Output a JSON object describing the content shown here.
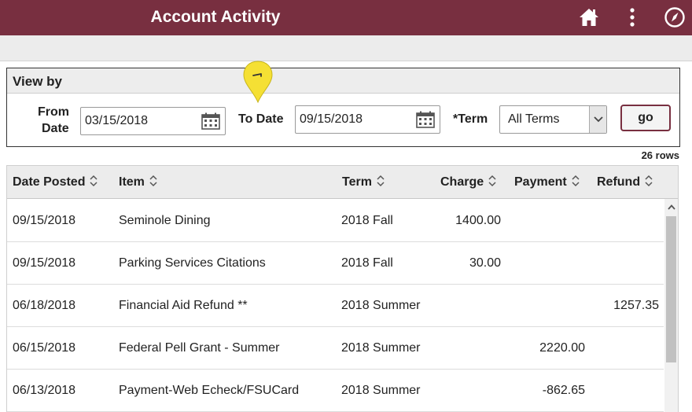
{
  "header": {
    "title": "Account Activity",
    "icons": [
      "home-icon",
      "more-vertical-icon",
      "compass-icon"
    ],
    "colors": {
      "brand": "#782f40"
    }
  },
  "view_by": {
    "heading": "View by",
    "from_label_1": "From",
    "from_label_2": "Date",
    "from_value": "03/15/2018",
    "to_label": "To Date",
    "to_value": "09/15/2018",
    "term_label": "*Term",
    "term_value": "All Terms",
    "go_label": "go"
  },
  "rows_count": "26 rows",
  "table": {
    "columns": [
      "Date Posted",
      "Item",
      "Term",
      "Charge",
      "Payment",
      "Refund"
    ],
    "rows": [
      {
        "date": "09/15/2018",
        "item": "Seminole Dining",
        "term": "2018 Fall",
        "charge": "1400.00",
        "payment": "",
        "refund": ""
      },
      {
        "date": "09/15/2018",
        "item": "Parking Services Citations",
        "term": "2018 Fall",
        "charge": "30.00",
        "payment": "",
        "refund": ""
      },
      {
        "date": "06/18/2018",
        "item": "Financial Aid Refund **",
        "term": "2018 Summer",
        "charge": "",
        "payment": "",
        "refund": "1257.35"
      },
      {
        "date": "06/15/2018",
        "item": "Federal Pell Grant - Summer",
        "term": "2018 Summer",
        "charge": "",
        "payment": "2220.00",
        "refund": ""
      },
      {
        "date": "06/13/2018",
        "item": "Payment-Web Echeck/FSUCard",
        "term": "2018 Summer",
        "charge": "",
        "payment": "-862.65",
        "refund": ""
      }
    ]
  }
}
